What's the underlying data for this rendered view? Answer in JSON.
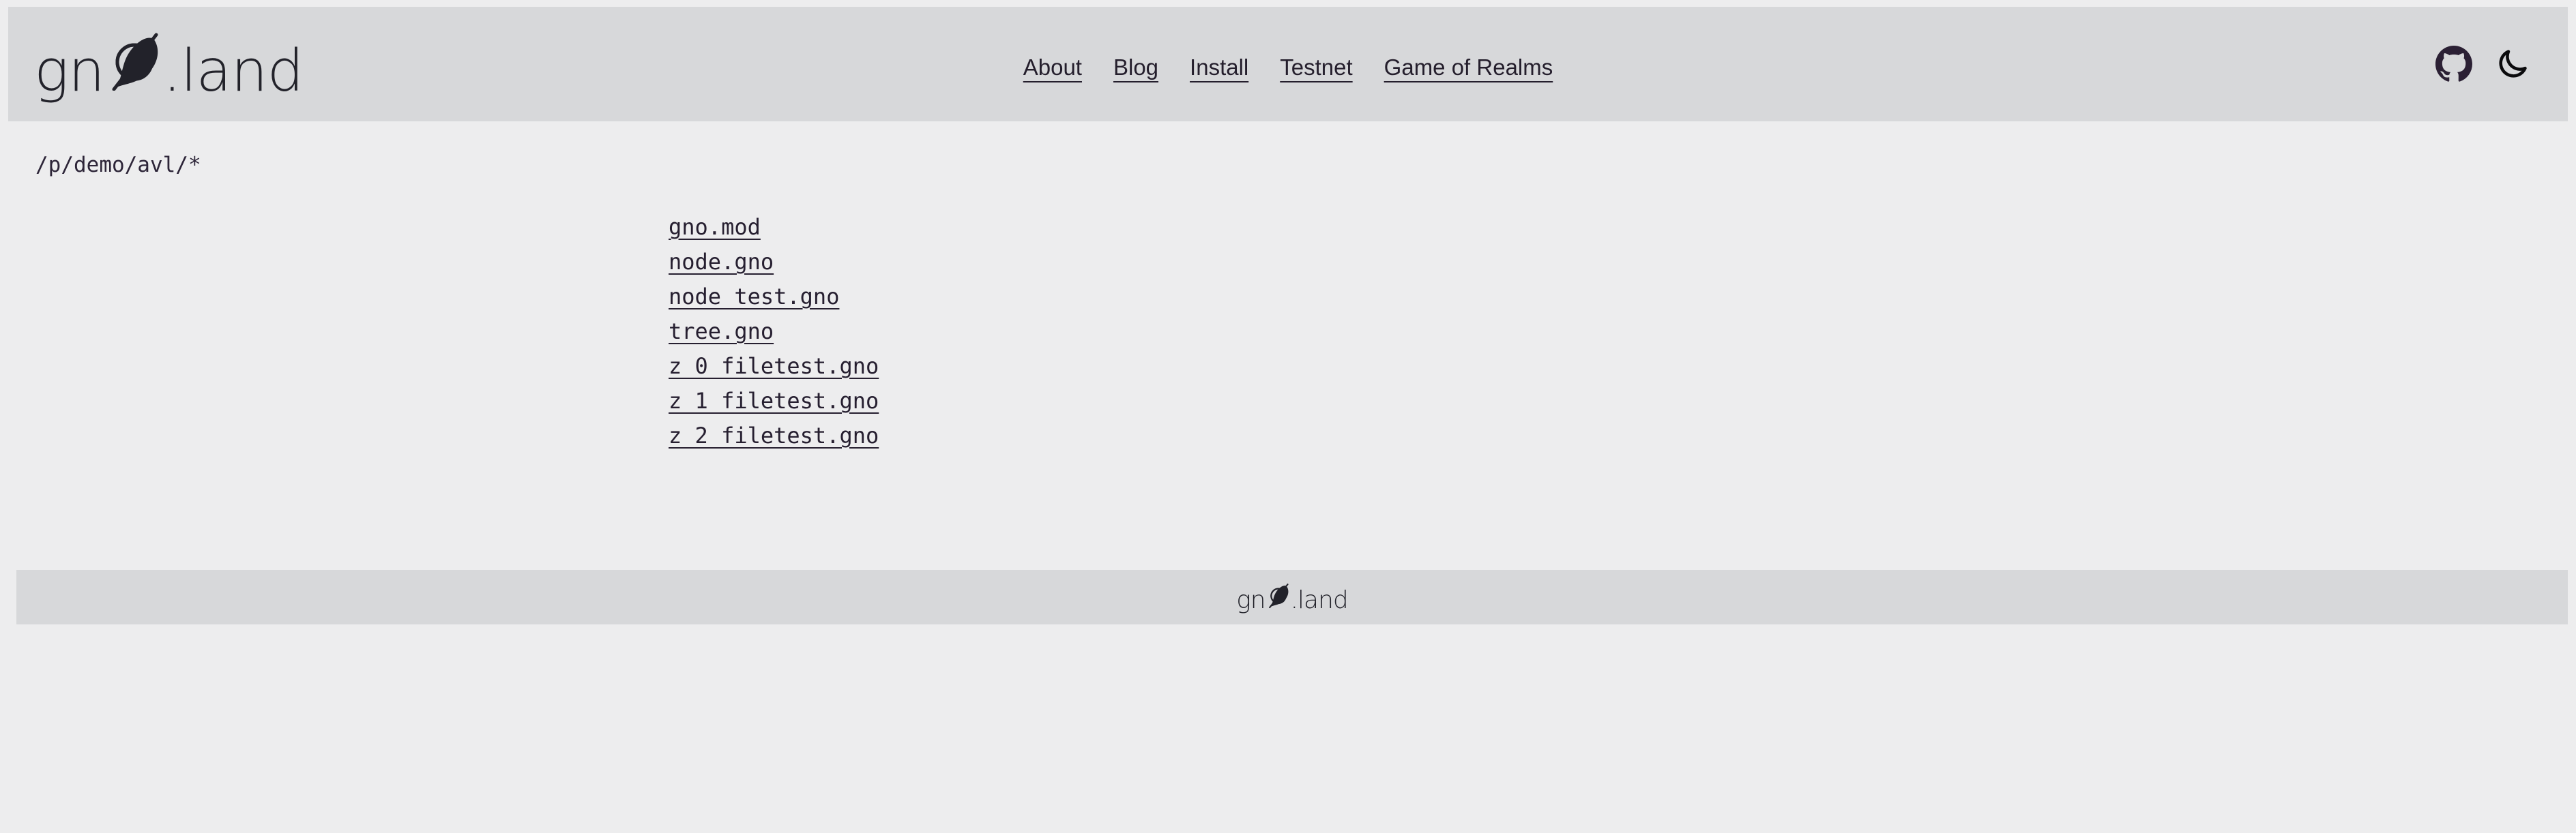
{
  "site": {
    "brand_pre": "gn",
    "brand_post": ".land",
    "brand_full": "gnØ.land",
    "background_color": "#ededee",
    "band_color": "#d7d8da",
    "text_color": "#241e2c"
  },
  "header": {
    "nav": [
      {
        "label": "About",
        "name": "nav-link-about"
      },
      {
        "label": "Blog",
        "name": "nav-link-blog"
      },
      {
        "label": "Install",
        "name": "nav-link-install"
      },
      {
        "label": "Testnet",
        "name": "nav-link-testnet"
      },
      {
        "label": "Game of Realms",
        "name": "nav-link-game-of-realms"
      }
    ],
    "icons": [
      {
        "name": "github-icon",
        "label": "GitHub"
      },
      {
        "name": "moon-icon",
        "label": "Dark mode"
      }
    ]
  },
  "main": {
    "breadcrumb": "/p/demo/avl/*",
    "files": [
      {
        "label": "gno.mod"
      },
      {
        "label": "node.gno"
      },
      {
        "label": "node_test.gno"
      },
      {
        "label": "tree.gno"
      },
      {
        "label": "z_0_filetest.gno"
      },
      {
        "label": "z_1_filetest.gno"
      },
      {
        "label": "z_2_filetest.gno"
      }
    ]
  },
  "footer": {
    "brand_pre": "gn",
    "brand_post": ".land"
  }
}
